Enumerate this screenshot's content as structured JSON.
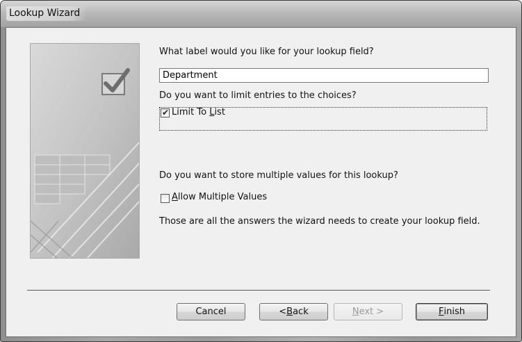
{
  "window": {
    "title": "Lookup Wizard"
  },
  "labels": {
    "label_question": "What label would you like for your lookup field?",
    "limit_question": "Do you want to limit entries to the choices?",
    "multi_question": "Do you want to store multiple values for this lookup?",
    "summary": "Those are all the answers the wizard needs to create your lookup field."
  },
  "fields": {
    "lookup_label": {
      "value": "Department"
    }
  },
  "checkboxes": {
    "limit_to_list": {
      "pre": "Limit To ",
      "accel": "L",
      "post": "ist",
      "checked": true
    },
    "allow_multiple": {
      "pre": "",
      "accel": "A",
      "post": "llow Multiple Values",
      "checked": false
    }
  },
  "buttons": {
    "cancel": {
      "pre": "Cancel",
      "accel": "",
      "post": ""
    },
    "back": {
      "pre": "< ",
      "accel": "B",
      "post": "ack"
    },
    "next": {
      "pre": "",
      "accel": "N",
      "post": "ext >",
      "enabled": false
    },
    "finish": {
      "pre": "",
      "accel": "F",
      "post": "inish"
    }
  },
  "icons": {
    "wizard_art": "checkbox-grid-illustration",
    "check": "checkmark-icon"
  },
  "colors": {
    "dialog_bg": "#f0f0f0",
    "titlebar": "#b9b9b9"
  }
}
